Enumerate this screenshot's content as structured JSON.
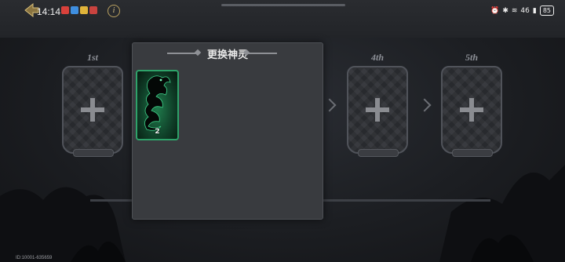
{
  "status_bar": {
    "time": "14:14",
    "battery": "85",
    "signal_text": "46"
  },
  "slots": [
    {
      "label": "1st"
    },
    {
      "label": "4th"
    },
    {
      "label": "5th"
    }
  ],
  "dialog": {
    "title": "更换神灵",
    "cards": [
      {
        "icon": "dragon-icon",
        "level_label": "2",
        "border_color": "#2ea36a"
      }
    ]
  },
  "footer": {
    "player_id": "ID:10001-635659"
  },
  "colors": {
    "background": "#1b1d21",
    "dialog_bg": "#393b3f",
    "card_border": "#2ea36a"
  }
}
